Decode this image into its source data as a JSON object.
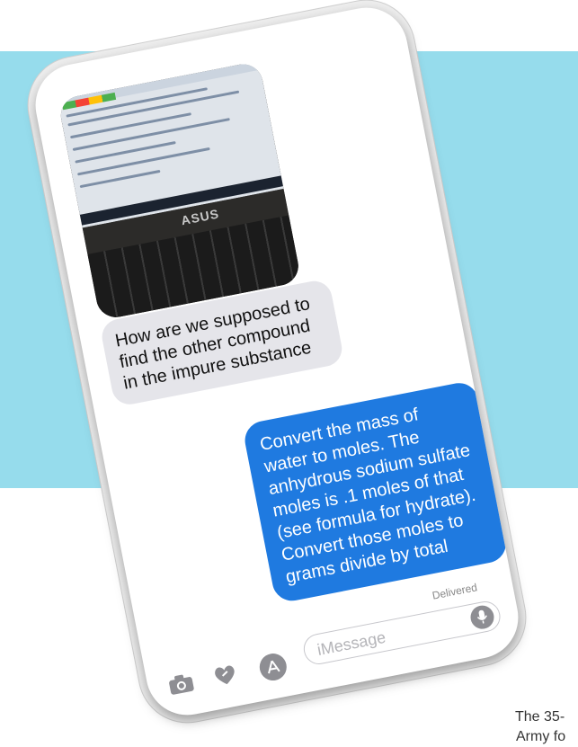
{
  "messages": {
    "incoming": "How are we supposed to find the other compound in the impure substance",
    "outgoing": "Convert the mass of water to moles. The anhydrous sodium sulfate moles is .1 moles of that (see formula for hydrate). Convert those moles to grams divide by total",
    "status": "Delivered"
  },
  "photo": {
    "brand": "ASUS"
  },
  "compose": {
    "placeholder": "iMessage"
  },
  "icons": {
    "camera": "camera-icon",
    "heart": "heart-icon",
    "apps": "app-store-icon",
    "mic": "microphone-icon"
  },
  "caption": {
    "line1": "The 35-",
    "line2": "Army fo"
  },
  "colors": {
    "accent": "#1f7ae0",
    "background_band": "#96dcec"
  }
}
